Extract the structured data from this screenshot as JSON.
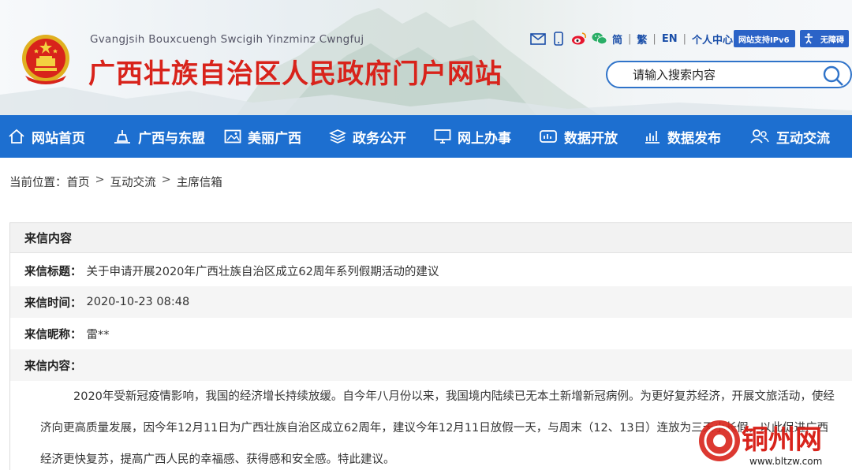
{
  "header": {
    "pinyin": "Gvangjsih Bouxcuengh Swcigih Yinzminz Cwngfuj",
    "title": "广西壮族自治区人民政府门户网站"
  },
  "toplinks": {
    "simplified": "简",
    "traditional": "繁",
    "english": "EN",
    "personal_center": "个人中心",
    "ipv6_badge": "网站支持IPv6",
    "accessibility_badge": "无障碍"
  },
  "search": {
    "placeholder": "请输入搜索内容"
  },
  "nav": {
    "items": [
      {
        "label": "网站首页",
        "icon": "home-icon"
      },
      {
        "label": "广西与东盟",
        "icon": "landmark-icon"
      },
      {
        "label": "美丽广西",
        "icon": "picture-icon"
      },
      {
        "label": "政务公开",
        "icon": "layers-icon"
      },
      {
        "label": "网上办事",
        "icon": "monitor-icon"
      },
      {
        "label": "数据开放",
        "icon": "data-open-icon"
      },
      {
        "label": "数据发布",
        "icon": "bar-chart-icon"
      },
      {
        "label": "互动交流",
        "icon": "users-icon"
      }
    ]
  },
  "breadcrumb": {
    "prefix": "当前位置：",
    "items": [
      "首页",
      "互动交流",
      "主席信箱"
    ],
    "separator": ">"
  },
  "letter": {
    "section_title": "来信内容",
    "subject_label": "来信标题：",
    "subject": "关于申请开展2020年广西壮族自治区成立62周年系列假期活动的建议",
    "time_label": "来信时间：",
    "time": "2020-10-23 08:48",
    "nickname_label": "来信昵称：",
    "nickname": "雷**",
    "content_label": "来信内容：",
    "content": "2020年受新冠疫情影响，我国的经济增长持续放缓。自今年八月份以来，我国境内陆续已无本土新增新冠病例。为更好复苏经济，开展文旅活动，使经济向更高质量发展，因今年12月11日为广西壮族自治区成立62周年，建议今年12月11日放假一天，与周末（12、13日）连放为三天小长假，以此促进广西经济更快复苏，提高广西人民的幸福感、获得感和安全感。特此建议。"
  },
  "watermark": {
    "name": "铜州网",
    "url": "www.bltzw.com"
  },
  "colors": {
    "title_red": "#d8231b",
    "nav_blue": "#1d6fd0",
    "link_blue": "#1a4ea8"
  }
}
